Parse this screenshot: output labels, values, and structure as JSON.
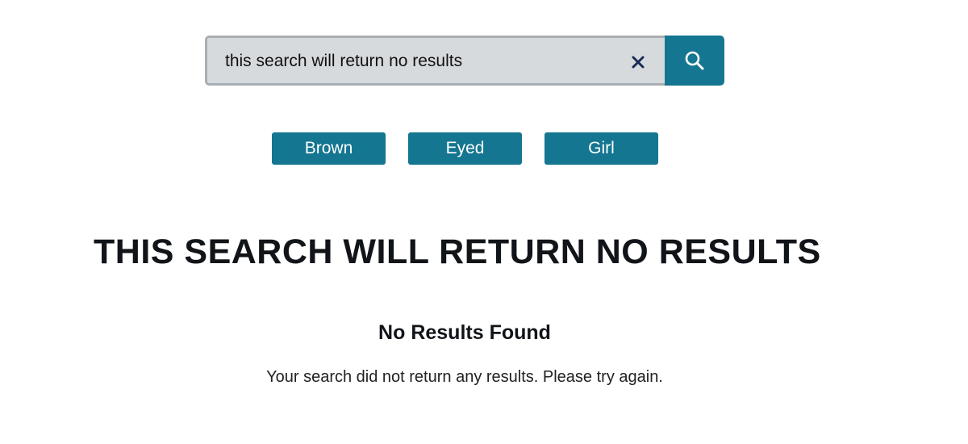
{
  "search": {
    "value": "this search will return no results",
    "clear_icon": "close-icon",
    "submit_icon": "search-icon"
  },
  "suggestions": [
    {
      "label": "Brown"
    },
    {
      "label": "Eyed"
    },
    {
      "label": "Girl"
    }
  ],
  "results": {
    "heading": "THIS SEARCH WILL RETURN NO RESULTS",
    "empty_title": "No Results Found",
    "empty_message": "Your search did not return any results. Please try again."
  },
  "colors": {
    "accent": "#147690",
    "field_bg": "#d7dadd",
    "field_border": "#a9aeb2",
    "clear_icon": "#1b2a55"
  }
}
